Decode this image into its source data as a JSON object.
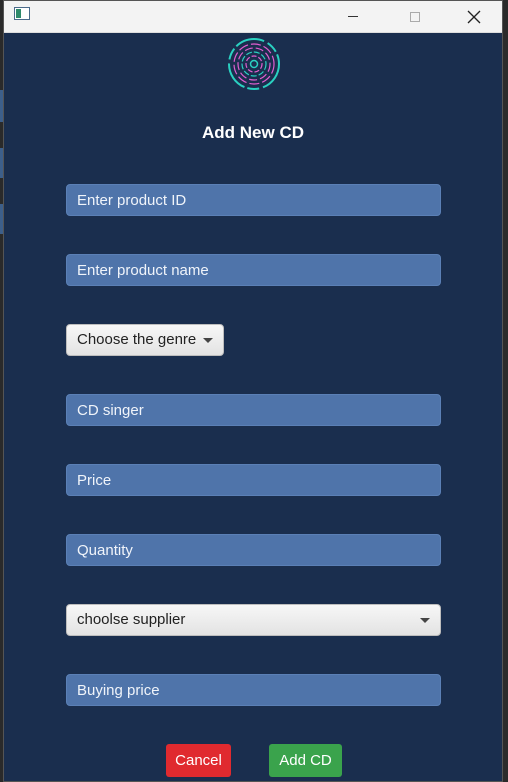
{
  "window": {
    "title_controls": {
      "minimize": "minimize",
      "maximize": "maximize",
      "close": "close"
    }
  },
  "header": {
    "logo_icon": "vinyl-disc-icon",
    "title": "Add New CD"
  },
  "form": {
    "product_id": {
      "placeholder": "Enter product ID"
    },
    "product_name": {
      "placeholder": "Enter product name"
    },
    "genre": {
      "selected": "Choose the genre"
    },
    "singer": {
      "placeholder": "CD singer"
    },
    "price": {
      "placeholder": "Price"
    },
    "quantity": {
      "placeholder": "Quantity"
    },
    "supplier": {
      "selected": "choolse supplier"
    },
    "buying_price": {
      "placeholder": "Buying price"
    }
  },
  "actions": {
    "cancel_label": "Cancel",
    "add_label": "Add CD"
  },
  "colors": {
    "window_bg": "#1a2e4e",
    "field_bg": "#4f74aa",
    "cancel": "#e02a2f",
    "add": "#3aa34c",
    "logo_cyan": "#2ad1c1",
    "logo_pink": "#e05fd0"
  }
}
